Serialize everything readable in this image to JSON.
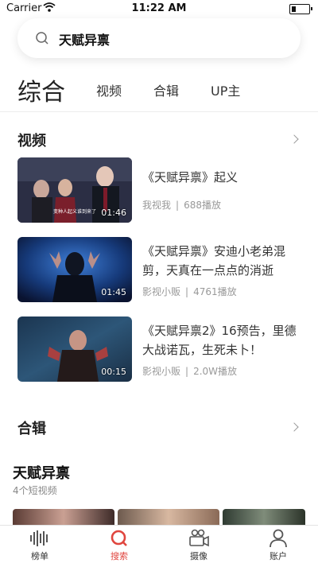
{
  "status_bar": {
    "carrier": "Carrier",
    "time": "11:22 AM"
  },
  "search": {
    "query": "天赋异禀"
  },
  "tabs": [
    {
      "label": "综合",
      "active": true
    },
    {
      "label": "视频"
    },
    {
      "label": "合辑"
    },
    {
      "label": "UP主"
    }
  ],
  "videos_section": {
    "title": "视频",
    "items": [
      {
        "title": "《天赋异禀》起义",
        "author": "我视我",
        "plays": "688播放",
        "duration": "01:46",
        "subtitle": "变种人起义谁到来了"
      },
      {
        "title": "《天赋异禀》安迪小老弟混剪，天真在一点点的消逝",
        "author": "影视小贩",
        "plays": "4761播放",
        "duration": "01:45"
      },
      {
        "title": "《天赋异禀2》16预告，里德大战诺瓦，生死未卜！",
        "author": "影视小贩",
        "plays": "2.0W播放",
        "duration": "00:15"
      }
    ]
  },
  "albums_section": {
    "title": "合辑"
  },
  "album": {
    "title": "天赋异禀",
    "count": "4个短视频"
  },
  "tab_bar": [
    {
      "label": "榜单",
      "icon": "chart-bars-icon"
    },
    {
      "label": "搜索",
      "icon": "search-icon",
      "active": true,
      "color": "#e0463f"
    },
    {
      "label": "摄像",
      "icon": "video-camera-icon"
    },
    {
      "label": "账户",
      "icon": "user-icon"
    }
  ]
}
